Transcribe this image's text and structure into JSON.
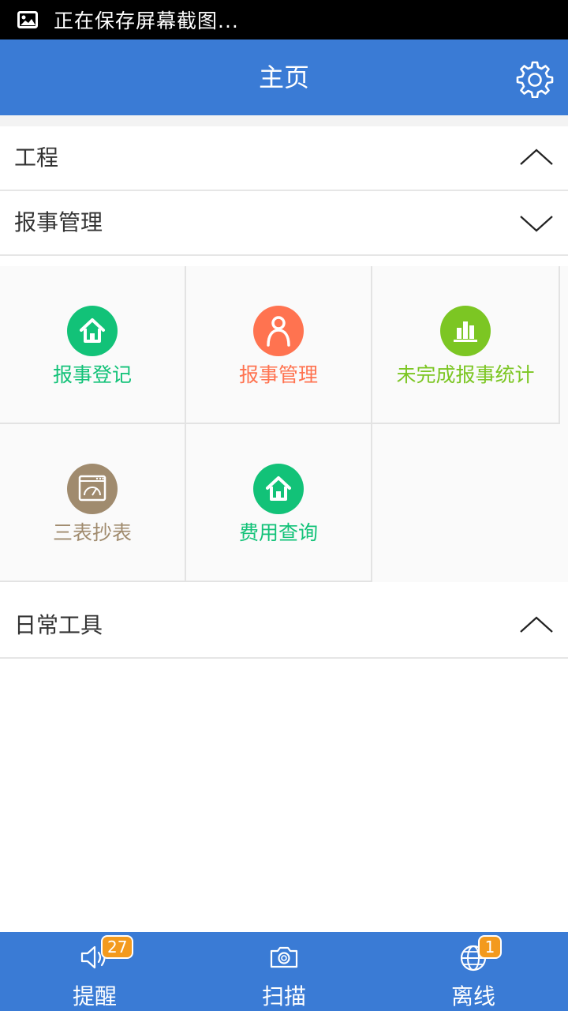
{
  "status_bar": {
    "text": "正在保存屏幕截图..."
  },
  "header": {
    "title": "主页"
  },
  "sections": [
    {
      "label": "工程",
      "state": "collapsed"
    },
    {
      "label": "报事管理",
      "state": "expanded"
    },
    {
      "label": "日常工具",
      "state": "collapsed"
    }
  ],
  "grid_items": [
    {
      "label": "报事登记",
      "icon": "home-icon",
      "color": "#12c278"
    },
    {
      "label": "报事管理",
      "icon": "person-icon",
      "color": "#ff7350"
    },
    {
      "label": "未完成报事统计",
      "icon": "bar-chart-icon",
      "color": "#7cc623"
    },
    {
      "label": "三表抄表",
      "icon": "meter-icon",
      "color": "#a08b6e"
    },
    {
      "label": "费用查询",
      "icon": "home-icon",
      "color": "#12c278"
    }
  ],
  "tabbar": {
    "tabs": [
      {
        "label": "提醒",
        "icon": "speaker-icon",
        "badge": "27"
      },
      {
        "label": "扫描",
        "icon": "camera-icon",
        "badge": ""
      },
      {
        "label": "离线",
        "icon": "globe-icon",
        "badge": "1"
      }
    ]
  },
  "colors": {
    "primary": "#3a7bd5",
    "badge": "#f39a1e"
  }
}
